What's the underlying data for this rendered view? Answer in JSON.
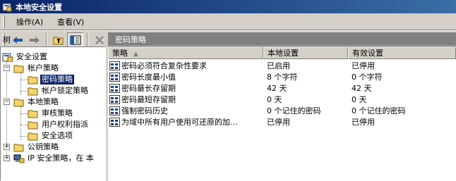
{
  "window": {
    "title": "本地安全设置"
  },
  "menu": {
    "items": [
      {
        "label": "操作(A)"
      },
      {
        "label": "查看(V)"
      }
    ]
  },
  "left": {
    "tab_label": "树",
    "tree": [
      {
        "label": "安全设置"
      },
      {
        "label": "帐户策略"
      },
      {
        "label": "密码策略"
      },
      {
        "label": "帐户锁定策略"
      },
      {
        "label": "本地策略"
      },
      {
        "label": "审核策略"
      },
      {
        "label": "用户权利指派"
      },
      {
        "label": "安全选项"
      },
      {
        "label": "公钥策略"
      },
      {
        "label": "IP 安全策略，在 本"
      }
    ]
  },
  "right": {
    "header": "密码策略",
    "columns": [
      {
        "label": "策略"
      },
      {
        "label": "本地设置"
      },
      {
        "label": "有效设置"
      }
    ],
    "sort_indicator": "▲",
    "rows": [
      {
        "policy": "密码必须符合复杂性要求",
        "local": "已启用",
        "effective": "已停用"
      },
      {
        "policy": "密码长度最小值",
        "local": "8 个字符",
        "effective": "0 个字符"
      },
      {
        "policy": "密码最长存留期",
        "local": "42 天",
        "effective": "42 天"
      },
      {
        "policy": "密码最短存留期",
        "local": "0 天",
        "effective": "0 天"
      },
      {
        "policy": "强制密码历史",
        "local": "0 个记住的密码",
        "effective": "0 个记住的密码"
      },
      {
        "policy": "为域中所有用户使用可还原的加...",
        "local": "已停用",
        "effective": "已停用"
      }
    ]
  },
  "colors": {
    "titlebar": "#0a246a",
    "selection": "#0a246a",
    "face": "#d4d0c8",
    "header_gray": "#808080"
  }
}
